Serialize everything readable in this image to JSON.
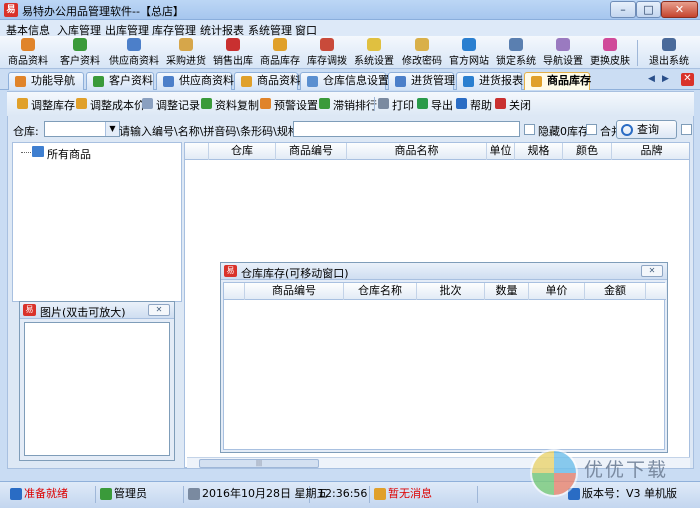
{
  "window": {
    "title": "易特办公用品管理软件--【总店】",
    "app_icon_char": "易",
    "min_label": "–",
    "max_label": "□",
    "close_label": "✕"
  },
  "menu": [
    "基本信息",
    "入库管理",
    "出库管理",
    "库存管理",
    "统计报表",
    "系统管理",
    "窗口"
  ],
  "toolbar": [
    {
      "label": "商品资料",
      "color": "#e0842a"
    },
    {
      "label": "客户资料",
      "color": "#3a9a3a"
    },
    {
      "label": "供应商资料",
      "color": "#4c7fc9"
    },
    {
      "label": "采购进货",
      "color": "#d6a64a"
    },
    {
      "label": "销售出库",
      "color": "#c93030"
    },
    {
      "label": "商品库存",
      "color": "#e0a02a"
    },
    {
      "label": "库存调拨",
      "color": "#c94a3a"
    },
    {
      "label": "系统设置",
      "color": "#e0c040"
    },
    {
      "label": "修改密码",
      "color": "#d9b04a"
    },
    {
      "label": "官方网站",
      "color": "#2a7fd0"
    },
    {
      "label": "锁定系统",
      "color": "#5a7fb0"
    },
    {
      "label": "导航设置",
      "color": "#9a7ac0"
    },
    {
      "label": "更换皮肤",
      "color": "#d04a9a"
    },
    {
      "label": "退出系统",
      "color": "#4a6a9a"
    }
  ],
  "tabs": [
    {
      "label": "功能导航",
      "color": "#e0842a"
    },
    {
      "label": "客户资料",
      "color": "#3a9a3a"
    },
    {
      "label": "供应商资料",
      "color": "#4c7fc9"
    },
    {
      "label": "商品资料",
      "color": "#e0a02a"
    },
    {
      "label": "仓库信息设置",
      "color": "#5a8fd0"
    },
    {
      "label": "进货管理",
      "color": "#4c7fc9"
    },
    {
      "label": "进货报表",
      "color": "#2a7fd0"
    },
    {
      "label": "商品库存",
      "color": "#e0a02a"
    }
  ],
  "tab_nav": {
    "prev": "◀",
    "next": "▶",
    "close": "✕"
  },
  "actions": [
    {
      "label": "调整库存",
      "color": "#e0a02a"
    },
    {
      "label": "调整成本价",
      "color": "#e0a02a"
    },
    {
      "label": "调整记录",
      "color": "#8aa0c0"
    },
    {
      "label": "资料复制",
      "color": "#3a9a3a"
    },
    {
      "label": "预警设置",
      "color": "#e0842a"
    },
    {
      "label": "滞销排行",
      "color": "#3a9a3a"
    },
    {
      "label": "打印",
      "color": "#7a8aa0"
    },
    {
      "label": "导出",
      "color": "#2a9a4a"
    },
    {
      "label": "帮助",
      "color": "#2a6cc4"
    },
    {
      "label": "关闭",
      "color": "#c93030"
    }
  ],
  "search": {
    "warehouse_label": "仓库:",
    "warehouse_value": "",
    "dropdown_arrow": "▼",
    "keyword_label": "请输入编号\\名称\\拼音码\\条形码\\规格查找:",
    "keyword_value": "",
    "hide_zero_label": "隐藏0库存",
    "merge_label": "合并",
    "query_label": "查询(Q)"
  },
  "tree": {
    "root_label": "所有商品"
  },
  "grid": {
    "columns": [
      "仓库",
      "商品编号",
      "商品名称",
      "单位",
      "规格",
      "颜色",
      "品牌"
    ],
    "rows": []
  },
  "scroll_grip": "|||",
  "picture_panel": {
    "title": "图片(双击可放大)",
    "close_label": "✕"
  },
  "warehouse_stock_window": {
    "title": "仓库库存(可移动窗口)",
    "close_label": "✕",
    "columns": [
      "商品编号",
      "仓库名称",
      "批次",
      "数量",
      "单价",
      "金额"
    ],
    "rows": []
  },
  "status": {
    "ready": "准备就绪",
    "user": "管理员",
    "date": "2016年10月28日 星期五",
    "time": "12:36:56",
    "message": "暂无消息",
    "version": "版本号：V3 单机版"
  },
  "watermark": {
    "text": "优优下载",
    "colors": [
      "#2aa0e0",
      "#e04a2a",
      "#3ab03a",
      "#e0c02a"
    ]
  }
}
